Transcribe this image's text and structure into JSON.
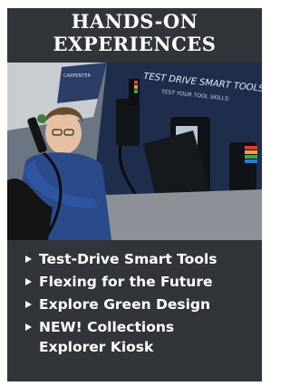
{
  "card": {
    "title_line1": "HANDS-ON",
    "title_line2": "EXPERIENCES",
    "photo": {
      "kiosk_heading": "TEST DRIVE SMART TOOLS",
      "kiosk_subheading": "TEST YOUR TOOL SKILLS:",
      "left_panel_text": "CARPENTER"
    },
    "items": [
      {
        "label": "Test-Drive Smart Tools",
        "icon": "triangle-right-icon"
      },
      {
        "label": "Flexing for the Future",
        "icon": "triangle-right-icon"
      },
      {
        "label": "Explore Green Design",
        "icon": "triangle-right-icon"
      },
      {
        "label_line1": "NEW! Collections",
        "label_line2": "Explorer Kiosk",
        "icon": "triangle-right-icon"
      }
    ]
  },
  "colors": {
    "card_background": "#31353a",
    "text": "#ffffff",
    "kiosk_panel": "#1e2a44"
  }
}
